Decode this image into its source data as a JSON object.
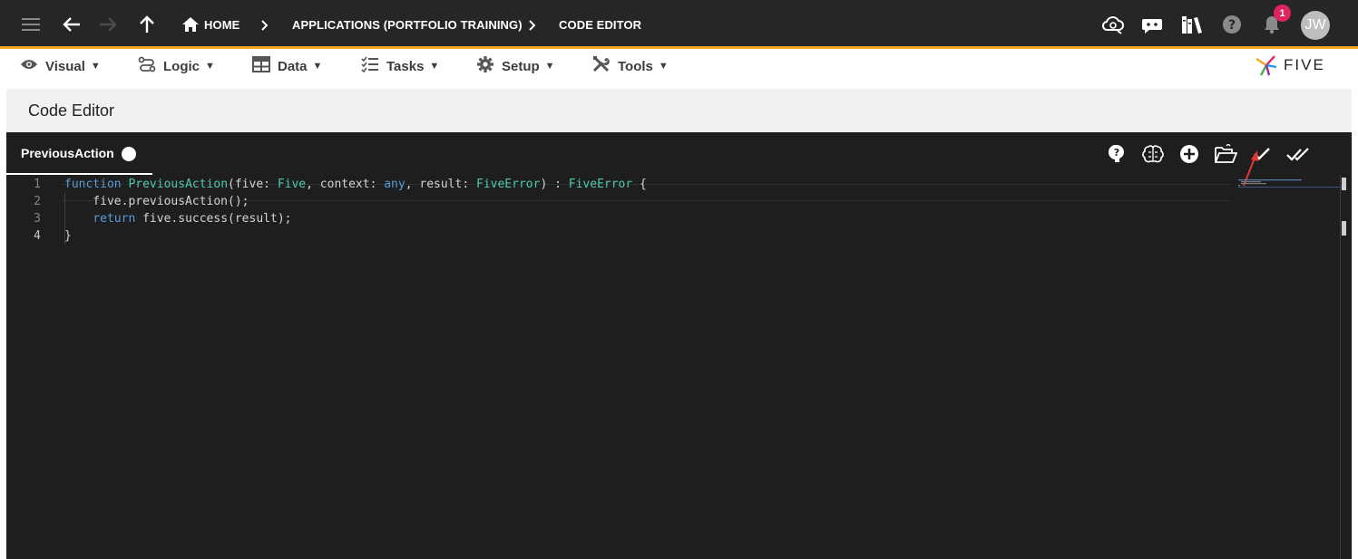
{
  "topbar": {
    "breadcrumbs": [
      "HOME",
      "APPLICATIONS (PORTFOLIO TRAINING)",
      "CODE EDITOR"
    ],
    "notification_count": "1",
    "avatar_initials": "JW",
    "icons": [
      "menu-icon",
      "back-arrow-icon",
      "forward-arrow-icon",
      "up-arrow-icon",
      "home-icon",
      "cloud-sync-icon",
      "chat-bot-icon",
      "library-books-icon",
      "help-icon",
      "bell-icon"
    ]
  },
  "menubar": {
    "items": [
      {
        "label": "Visual",
        "icon": "eye-icon"
      },
      {
        "label": "Logic",
        "icon": "logic-flow-icon"
      },
      {
        "label": "Data",
        "icon": "table-icon"
      },
      {
        "label": "Tasks",
        "icon": "checklist-icon"
      },
      {
        "label": "Setup",
        "icon": "gear-icon"
      },
      {
        "label": "Tools",
        "icon": "tools-icon"
      }
    ],
    "caret": "▼",
    "logo_text": "FIVE"
  },
  "page": {
    "title": "Code Editor"
  },
  "editor": {
    "tab_label": "PreviousAction",
    "toolbar_icons": [
      "help-bubble-icon",
      "brain-icon",
      "add-circle-icon",
      "open-folder-icon",
      "check-icon",
      "double-check-icon"
    ],
    "lines": [
      {
        "number": "1",
        "tokens": [
          {
            "t": "function",
            "c": "kw"
          },
          {
            "t": " ",
            "c": ""
          },
          {
            "t": "PreviousAction",
            "c": "fn"
          },
          {
            "t": "(five: ",
            "c": ""
          },
          {
            "t": "Five",
            "c": "ty"
          },
          {
            "t": ", context: ",
            "c": ""
          },
          {
            "t": "any",
            "c": "kw"
          },
          {
            "t": ", result: ",
            "c": ""
          },
          {
            "t": "FiveError",
            "c": "ty"
          },
          {
            "t": ") : ",
            "c": ""
          },
          {
            "t": "FiveError",
            "c": "ty"
          },
          {
            "t": " {",
            "c": ""
          }
        ]
      },
      {
        "number": "2",
        "tokens": [
          {
            "t": "    five.previousAction();",
            "c": ""
          }
        ]
      },
      {
        "number": "3",
        "tokens": [
          {
            "t": "    ",
            "c": ""
          },
          {
            "t": "return",
            "c": "kw"
          },
          {
            "t": " five.success(result);",
            "c": ""
          }
        ]
      },
      {
        "number": "4",
        "tokens": [
          {
            "t": "}",
            "c": ""
          }
        ]
      }
    ]
  },
  "colors": {
    "topbar_bg": "#262626",
    "accent": "#f4a81d",
    "badge": "#e0245e",
    "editor_bg": "#1e1e1e",
    "keyword": "#569cd6",
    "type": "#4ec9b0"
  }
}
